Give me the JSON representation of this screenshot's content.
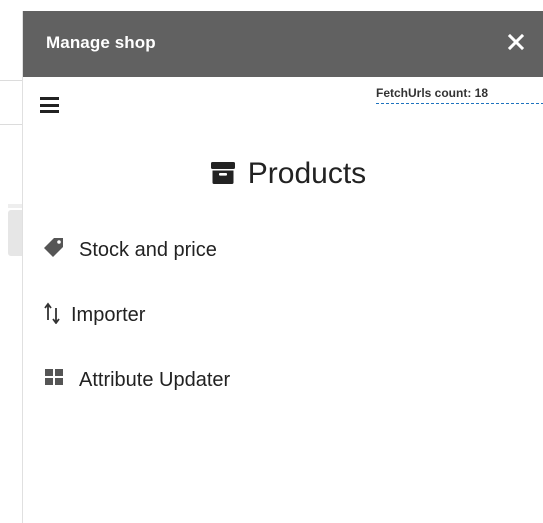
{
  "drawer": {
    "title": "Manage shop",
    "close_icon": "close-icon"
  },
  "toolbar": {
    "menu_icon": "hamburger-menu-icon",
    "fetch_count_text": "FetchUrls count: 18"
  },
  "section": {
    "title": "Products",
    "icon": "archive-box-icon"
  },
  "menu": {
    "items": [
      {
        "label": "Stock and price",
        "icon": "tag-icon"
      },
      {
        "label": "Importer",
        "icon": "sort-arrows-icon"
      },
      {
        "label": "Attribute Updater",
        "icon": "grid-icon"
      }
    ]
  },
  "colors": {
    "header_bg": "#616161",
    "header_text": "#ffffff",
    "link_underline": "#1e73be",
    "text": "#222222"
  }
}
